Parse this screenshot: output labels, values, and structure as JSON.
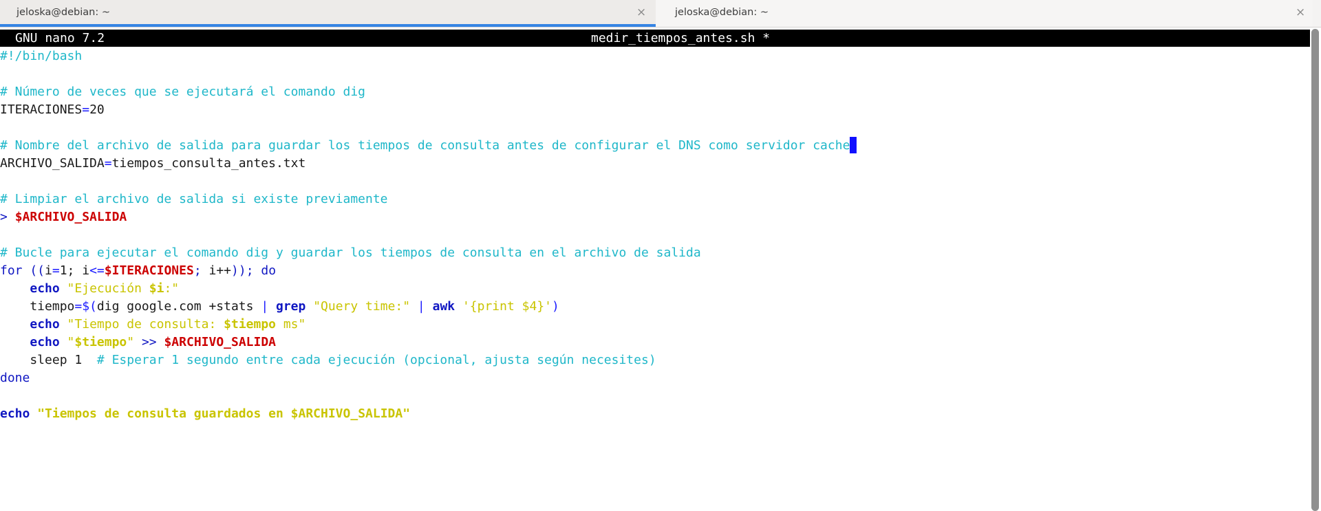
{
  "tabs": [
    {
      "title": "jeloska@debian: ~",
      "close": "×",
      "active": true
    },
    {
      "title": "jeloska@debian: ~",
      "close": "×",
      "active": false
    }
  ],
  "nano": {
    "app": "GNU nano 7.2",
    "filename": "medir_tiempos_antes.sh *"
  },
  "colors": {
    "tab_indicator": "#3584e4",
    "comment": "#1fb7c9",
    "keyword": "#0f16c2",
    "string": "#c9c400",
    "variable": "#cc0000"
  },
  "code": {
    "l1": "#!/bin/bash",
    "l3": "# Número de veces que se ejecutará el comando dig",
    "l4a": "ITERACIONES",
    "l4b": "=",
    "l4c": "20",
    "l6": "# Nombre del archivo de salida para guardar los tiempos de consulta antes de configurar el DNS como servidor cache",
    "l7a": "ARCHIVO_SALIDA",
    "l7b": "=",
    "l7c": "tiempos_consulta_antes.txt",
    "l9": "# Limpiar el archivo de salida si existe previamente",
    "l10a": "> ",
    "l10b": "$ARCHIVO_SALIDA",
    "l12": "# Bucle para ejecutar el comando dig y guardar los tiempos de consulta en el archivo de salida",
    "l13a": "for ((",
    "l13b": "i",
    "l13c": "=",
    "l13d": "1; i",
    "l13e": "<=",
    "l13f": "$ITERACIONES",
    "l13g": "; ",
    "l13h": "i++",
    "l13i": ")); do",
    "l14a": "    ",
    "l14b": "echo",
    "l14c": " \"Ejecución ",
    "l14d": "$i",
    "l14e": ":\"",
    "l15a": "    tiempo",
    "l15b": "=$(",
    "l15c": "dig google.com +stats ",
    "l15d": "|",
    "l15e": " ",
    "l15f": "grep",
    "l15g": " \"Query time:\" ",
    "l15h": "|",
    "l15i": " ",
    "l15j": "awk",
    "l15k": " '{print $4}'",
    "l15l": ")",
    "l16a": "    ",
    "l16b": "echo",
    "l16c": " \"Tiempo de consulta: ",
    "l16d": "$tiempo",
    "l16e": " ms\"",
    "l17a": "    ",
    "l17b": "echo",
    "l17c": " \"",
    "l17d": "$tiempo",
    "l17e": "\"",
    "l17f": " >> ",
    "l17g": "$ARCHIVO_SALIDA",
    "l18a": "    sleep 1  ",
    "l18b": "# Esperar 1 segundo entre cada ejecución (opcional, ajusta según necesites)",
    "l19": "done",
    "l21a": "echo",
    "l21b": " \"Tiempos de consulta guardados en ",
    "l21c": "$ARCHIVO_SALIDA",
    "l21d": "\""
  }
}
